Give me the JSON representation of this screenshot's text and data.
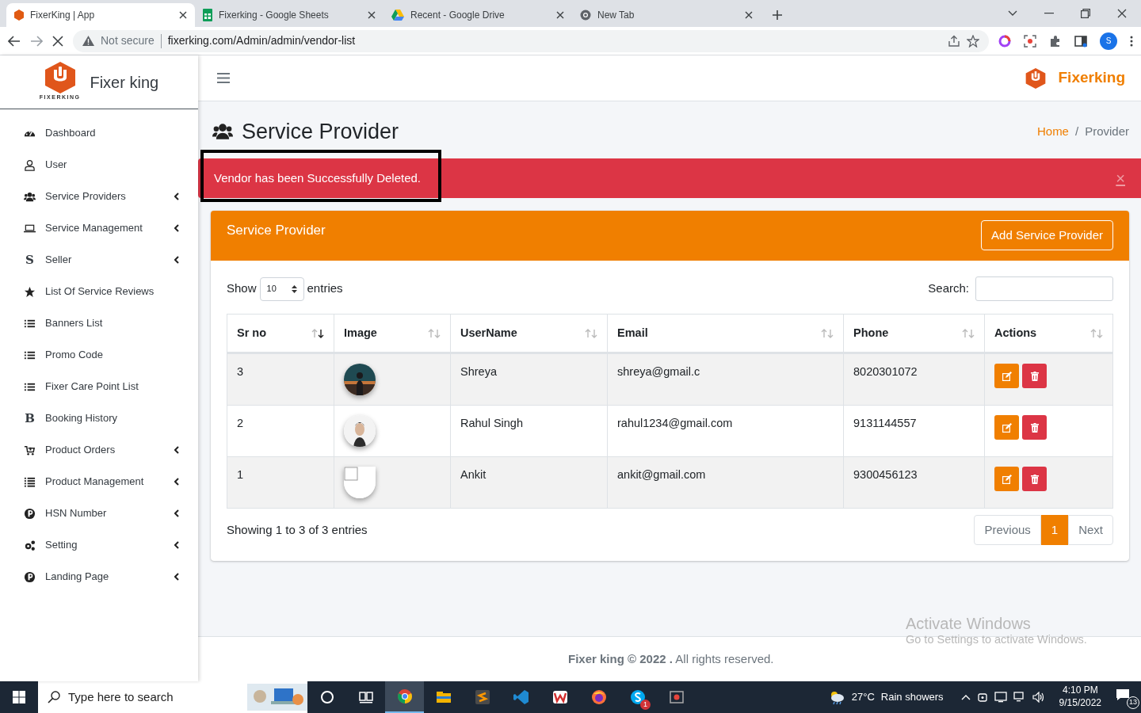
{
  "browser": {
    "tabs": [
      {
        "title": "FixerKing | App",
        "selected": true
      },
      {
        "title": "Fixerking - Google Sheets",
        "selected": false
      },
      {
        "title": "Recent - Google Drive",
        "selected": false
      },
      {
        "title": "New Tab",
        "selected": false
      }
    ],
    "security": "Not secure",
    "url": "fixerking.com/Admin/admin/vendor-list",
    "profile_initial": "S"
  },
  "sidebar": {
    "brand": "Fixer king",
    "logo_caption": "FIXERKING",
    "items": [
      {
        "label": "Dashboard",
        "has_submenu": false
      },
      {
        "label": "User",
        "has_submenu": false
      },
      {
        "label": "Service Providers",
        "has_submenu": true
      },
      {
        "label": "Service Management",
        "has_submenu": true
      },
      {
        "label": "Seller",
        "has_submenu": true,
        "icon_text": "S"
      },
      {
        "label": "List Of Service Reviews",
        "has_submenu": false
      },
      {
        "label": "Banners List",
        "has_submenu": false
      },
      {
        "label": "Promo Code",
        "has_submenu": false
      },
      {
        "label": "Fixer Care Point List",
        "has_submenu": false
      },
      {
        "label": "Booking History",
        "has_submenu": false,
        "icon_text": "B"
      },
      {
        "label": "Product Orders",
        "has_submenu": true
      },
      {
        "label": "Product Management",
        "has_submenu": true
      },
      {
        "label": "HSN Number",
        "has_submenu": true
      },
      {
        "label": "Setting",
        "has_submenu": true
      },
      {
        "label": "Landing Page",
        "has_submenu": true
      }
    ]
  },
  "topbar": {
    "brand": "Fixerking"
  },
  "page": {
    "title": "Service Provider",
    "breadcrumb_separator": "/",
    "breadcrumb": [
      {
        "label": "Home",
        "selected": false
      },
      {
        "label": "Provider",
        "selected": true
      }
    ]
  },
  "alert": {
    "message": "Vendor has been Successfully Deleted.",
    "close": "×",
    "highlighted": true
  },
  "card": {
    "title": "Service Provider",
    "add_button": "Add Service Provider",
    "show_label": "Show",
    "length_value": "10",
    "entries_label": "entries",
    "search_label": "Search:",
    "columns": [
      {
        "label": "Sr no",
        "sorted_descending": true
      },
      {
        "label": "Image",
        "sorted_descending": false
      },
      {
        "label": "UserName",
        "sorted_descending": false
      },
      {
        "label": "Email",
        "sorted_descending": false
      },
      {
        "label": "Phone",
        "sorted_descending": false
      },
      {
        "label": "Actions",
        "sorted_descending": false
      }
    ],
    "rows": [
      {
        "sr_no": "3",
        "username": "Shreya",
        "email": "shreya@gmail.c",
        "phone": "8020301072"
      },
      {
        "sr_no": "2",
        "username": "Rahul Singh",
        "email": "rahul1234@gmail.com",
        "phone": "9131144557"
      },
      {
        "sr_no": "1",
        "image": {
          "kind": "broken"
        },
        "username": "Ankit",
        "email": "ankit@gmail.com",
        "phone": "9300456123"
      }
    ],
    "info": "Showing 1 to 3 of 3 entries",
    "pagination": [
      {
        "label": "Previous",
        "selected": false
      },
      {
        "label": "1",
        "selected": true
      },
      {
        "label": "Next",
        "selected": false
      }
    ]
  },
  "footer": "**Fixer king © 2022 .** All rights reserved.",
  "windows_notice": {
    "title": "Activate Windows",
    "subtitle": "Go to Settings to activate Windows."
  },
  "taskbar": {
    "search_placeholder": "Type here to search",
    "apps": [
      {
        "selected": false
      },
      {
        "selected": false
      },
      {
        "selected": true
      },
      {
        "selected": false
      },
      {
        "selected": false
      },
      {
        "selected": false
      },
      {
        "selected": false
      },
      {
        "selected": false
      },
      {
        "selected": false,
        "badge": "1"
      },
      {
        "selected": false
      }
    ],
    "temperature": "27°C",
    "weather": "Rain showers",
    "time": "4:10 PM",
    "date": "9/15/2022",
    "notifications": "13"
  }
}
